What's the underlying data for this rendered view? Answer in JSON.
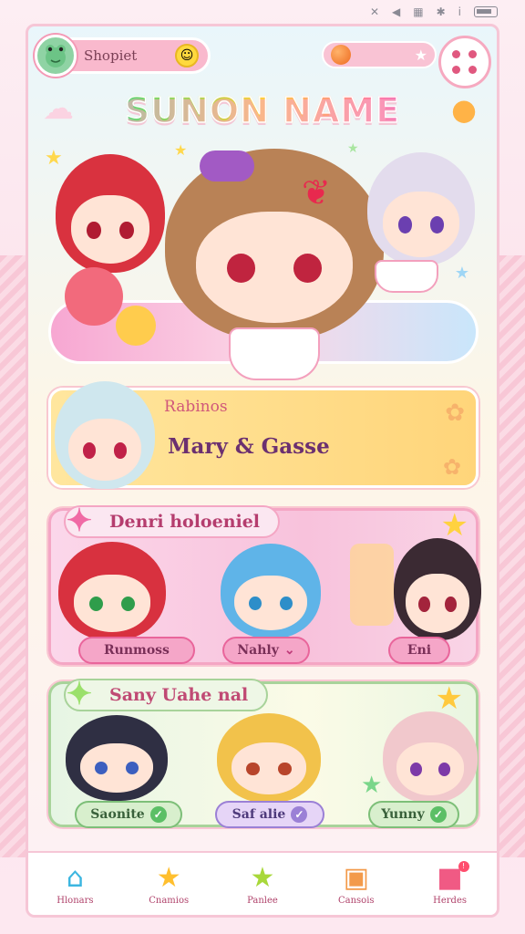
{
  "status": {
    "icons": [
      "signal-icon",
      "volume-icon",
      "wifi-icon",
      "battery-icon"
    ]
  },
  "header": {
    "player_name": "Shopiet",
    "game_title": "SUNON NAME"
  },
  "featured": {
    "subtitle": "Rabinos",
    "name": "Mary & Gasse"
  },
  "group1": {
    "title": "Denri holoeniel",
    "chips": [
      {
        "label": "Runmoss"
      },
      {
        "label": "Nahly"
      },
      {
        "label": "Eni"
      }
    ]
  },
  "group2": {
    "title": "Sany Uahe nal",
    "chips": [
      {
        "label": "Saonite"
      },
      {
        "label": "Saf alie"
      },
      {
        "label": "Yunny"
      }
    ]
  },
  "nav": [
    {
      "label": "Hlonars",
      "icon": "home-icon"
    },
    {
      "label": "Cnamios",
      "icon": "star-icon"
    },
    {
      "label": "Panlee",
      "icon": "green-star-icon"
    },
    {
      "label": "Cansois",
      "icon": "shop-icon"
    },
    {
      "label": "Herdes",
      "icon": "gift-icon"
    }
  ],
  "colors": {
    "accent_pink": "#f49ab6",
    "title_gradient": [
      "#4dc4ff",
      "#77d66b",
      "#ffcc3d",
      "#ff7aa8",
      "#b07cff"
    ],
    "featured_bg": "#ffd57a",
    "group1_bg": "#f8c2dc",
    "group2_bg": "#e6f5e4"
  }
}
